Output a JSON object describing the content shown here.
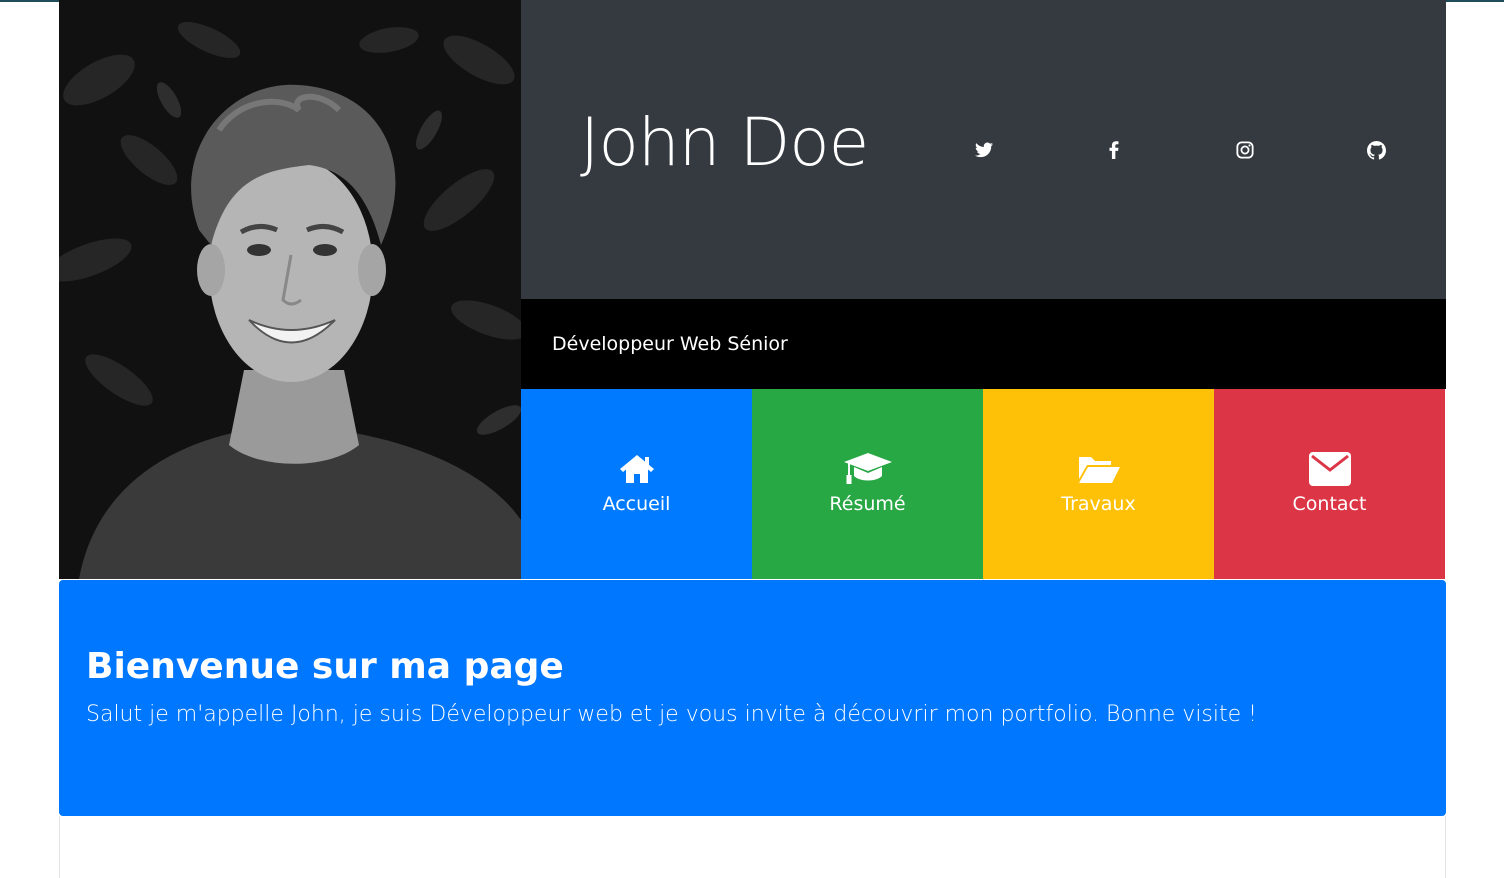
{
  "profile": {
    "name": "John Doe",
    "subtitle": "Développeur Web Sénior",
    "photo_icon": "portrait-photo"
  },
  "social": [
    {
      "icon": "twitter-icon"
    },
    {
      "icon": "facebook-icon"
    },
    {
      "icon": "instagram-icon"
    },
    {
      "icon": "github-icon"
    }
  ],
  "nav": [
    {
      "label": "Accueil",
      "icon": "home-icon",
      "color": "#007bff"
    },
    {
      "label": "Résumé",
      "icon": "graduation-cap-icon",
      "color": "#28a745"
    },
    {
      "label": "Travaux",
      "icon": "folder-open-icon",
      "color": "#ffc107"
    },
    {
      "label": "Contact",
      "icon": "envelope-icon",
      "color": "#dc3545"
    }
  ],
  "welcome": {
    "title": "Bienvenue sur ma page",
    "text": "Salut je m'appelle John, je suis Développeur web et je vous invite à découvrir mon portfolio. Bonne visite !"
  },
  "colors": {
    "header": "#343a40",
    "subbar": "#000000",
    "welcome": "#0077ff"
  }
}
